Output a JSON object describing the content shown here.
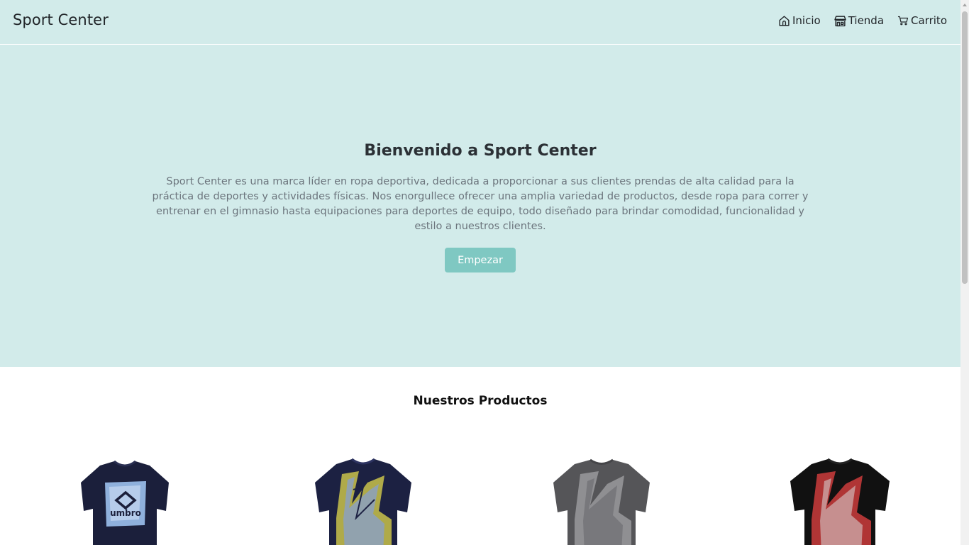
{
  "navbar": {
    "brand": "Sport Center",
    "links": [
      {
        "label": "Inicio",
        "icon": "home-icon"
      },
      {
        "label": "Tienda",
        "icon": "store-icon"
      },
      {
        "label": "Carrito",
        "icon": "cart-icon"
      }
    ]
  },
  "hero": {
    "title": "Bienvenido a Sport Center",
    "text": "Sport Center es una marca líder en ropa deportiva, dedicada a proporcionar a sus clientes prendas de alta calidad para la práctica de deportes y actividades físicas. Nos enorgullece ofrecer una amplia variedad de productos, desde ropa para correr y entrenar en el gimnasio hasta equipaciones para deportes de equipo, todo diseñado para brindar comodidad, funcionalidad y estilo a nuestros clientes.",
    "button": "Empezar"
  },
  "products": {
    "title": "Nuestros Productos",
    "items": [
      {
        "brand_print": "umbro",
        "shirt_color": "#1b1f3b",
        "print_color": "#8fb0dc"
      },
      {
        "shirt_color": "#1c2142",
        "print_color": "#c9c24a"
      },
      {
        "shirt_color": "#555558",
        "print_color": "#9a9a9c"
      },
      {
        "shirt_color": "#111111",
        "print_color": "#c23a3a"
      }
    ]
  },
  "colors": {
    "hero_bg": "#d2ebea",
    "button_bg": "#7fc8c2"
  }
}
